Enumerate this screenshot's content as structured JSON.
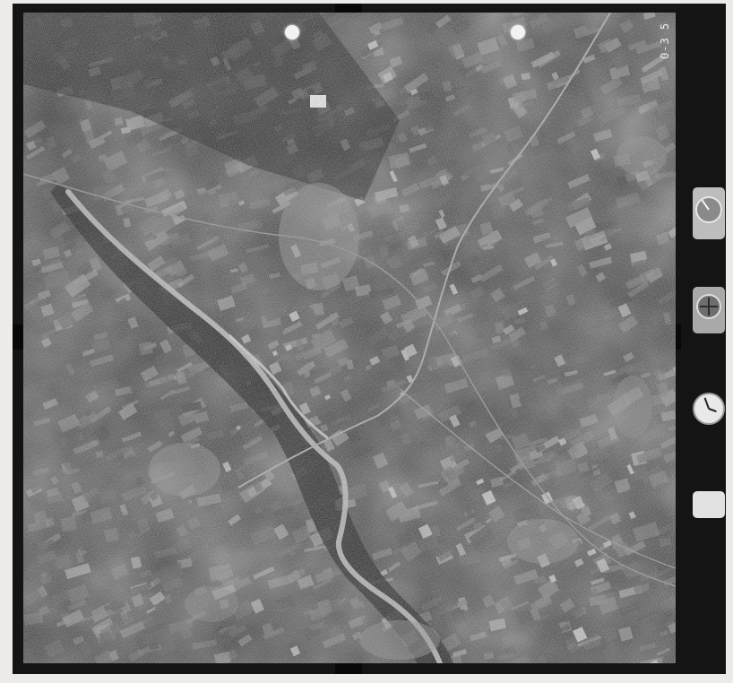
{
  "frame_label": "0-3 5",
  "colors": {
    "film_border": "#141414",
    "page_background": "#ecebe8",
    "terrain_dark": "#2f2f2f",
    "field_light": "#7c7c7c",
    "river_bed": "#b9b9b9",
    "road": "#9a9a9a",
    "urban": "#8f8f8f"
  },
  "icons": {
    "altimeter": "altimeter-icon",
    "level_bubble": "level-bubble-icon",
    "clock": "clock-icon",
    "counter": "counter-tag-icon",
    "fiducial": "fiducial-mark-icon"
  }
}
